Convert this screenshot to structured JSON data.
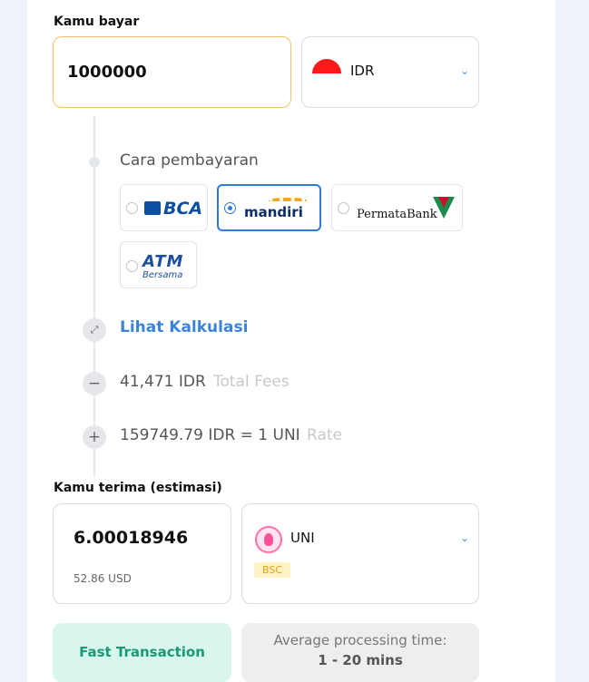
{
  "pay": {
    "label": "Kamu bayar",
    "amount": "1000000",
    "currency": "IDR",
    "currency_flag": "indonesia-flag"
  },
  "payment_method": {
    "label": "Cara pembayaran",
    "banks": [
      {
        "name": "BCA",
        "selected": false
      },
      {
        "name": "mandiri",
        "selected": true
      },
      {
        "name": "PermataBank",
        "selected": false
      },
      {
        "name": "ATM Bersama",
        "logo_text": "ATM",
        "logo_sub": "Bersama",
        "selected": false
      }
    ]
  },
  "calc": {
    "link": "Lihat Kalkulasi",
    "fees_value": "41,471 IDR",
    "fees_label": "Total Fees",
    "rate_value": "159749.79 IDR = 1 UNI",
    "rate_label": "Rate"
  },
  "receive": {
    "label": "Kamu terima (estimasi)",
    "amount": "6.00018946",
    "usd": "52.86 USD",
    "currency": "UNI",
    "network": "BSC",
    "currency_icon": "uniswap-icon"
  },
  "footer": {
    "fast_label": "Fast Transaction",
    "avg_label": "Average processing time:",
    "avg_value": "1 - 20 mins"
  },
  "colors": {
    "accent_blue": "#3d84d8",
    "input_border": "#f1c46a",
    "fast_bg": "#d8f5ee",
    "fast_text": "#199a72"
  }
}
